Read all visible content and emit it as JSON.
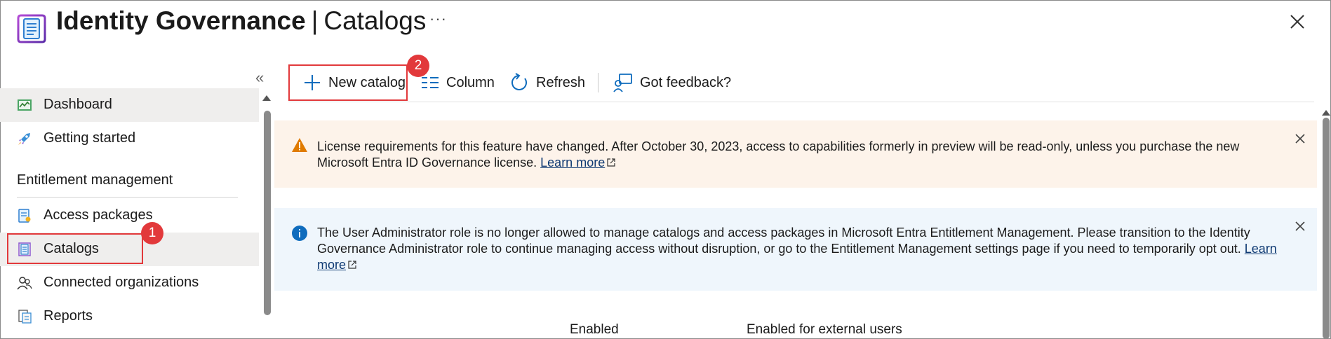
{
  "header": {
    "title_main": "Identity Governance",
    "title_sep": "|",
    "title_sub": "Catalogs",
    "more_label": "···"
  },
  "sidebar": {
    "collapse_label": "«",
    "items": [
      {
        "label": "Dashboard",
        "icon": "dashboard-icon"
      },
      {
        "label": "Getting started",
        "icon": "rocket-icon"
      }
    ],
    "section_title": "Entitlement management",
    "section_items": [
      {
        "label": "Access packages",
        "icon": "access-package-icon"
      },
      {
        "label": "Catalogs",
        "icon": "catalog-icon"
      },
      {
        "label": "Connected organizations",
        "icon": "people-icon"
      },
      {
        "label": "Reports",
        "icon": "reports-icon"
      }
    ]
  },
  "toolbar": {
    "new_catalog": "New catalog",
    "column": "Column",
    "refresh": "Refresh",
    "feedback": "Got feedback?"
  },
  "annotations": {
    "badge_1": "1",
    "badge_2": "2"
  },
  "banners": {
    "warning_text": "License requirements for this feature have changed. After October 30, 2023, access to capabilities formerly in preview will be read-only, unless you purchase the new Microsoft Entra ID Governance license.",
    "warning_link": "Learn more",
    "info_text": "The User Administrator role is no longer allowed to manage catalogs and access packages in Microsoft Entra Entitlement Management. Please transition to the Identity Governance Administrator role to continue managing access without disruption, or go to the Entitlement Management settings page if you need to temporarily opt out.",
    "info_link": "Learn more"
  },
  "table": {
    "columns": [
      "Enabled",
      "Enabled for external users"
    ]
  },
  "colors": {
    "highlight": "#e2393b",
    "warning_bg": "#fdf3ea",
    "info_bg": "#eff6fc",
    "warning_icon": "#e07b00",
    "info_icon": "#0f6cbd",
    "accent": "#0f6cbd"
  }
}
